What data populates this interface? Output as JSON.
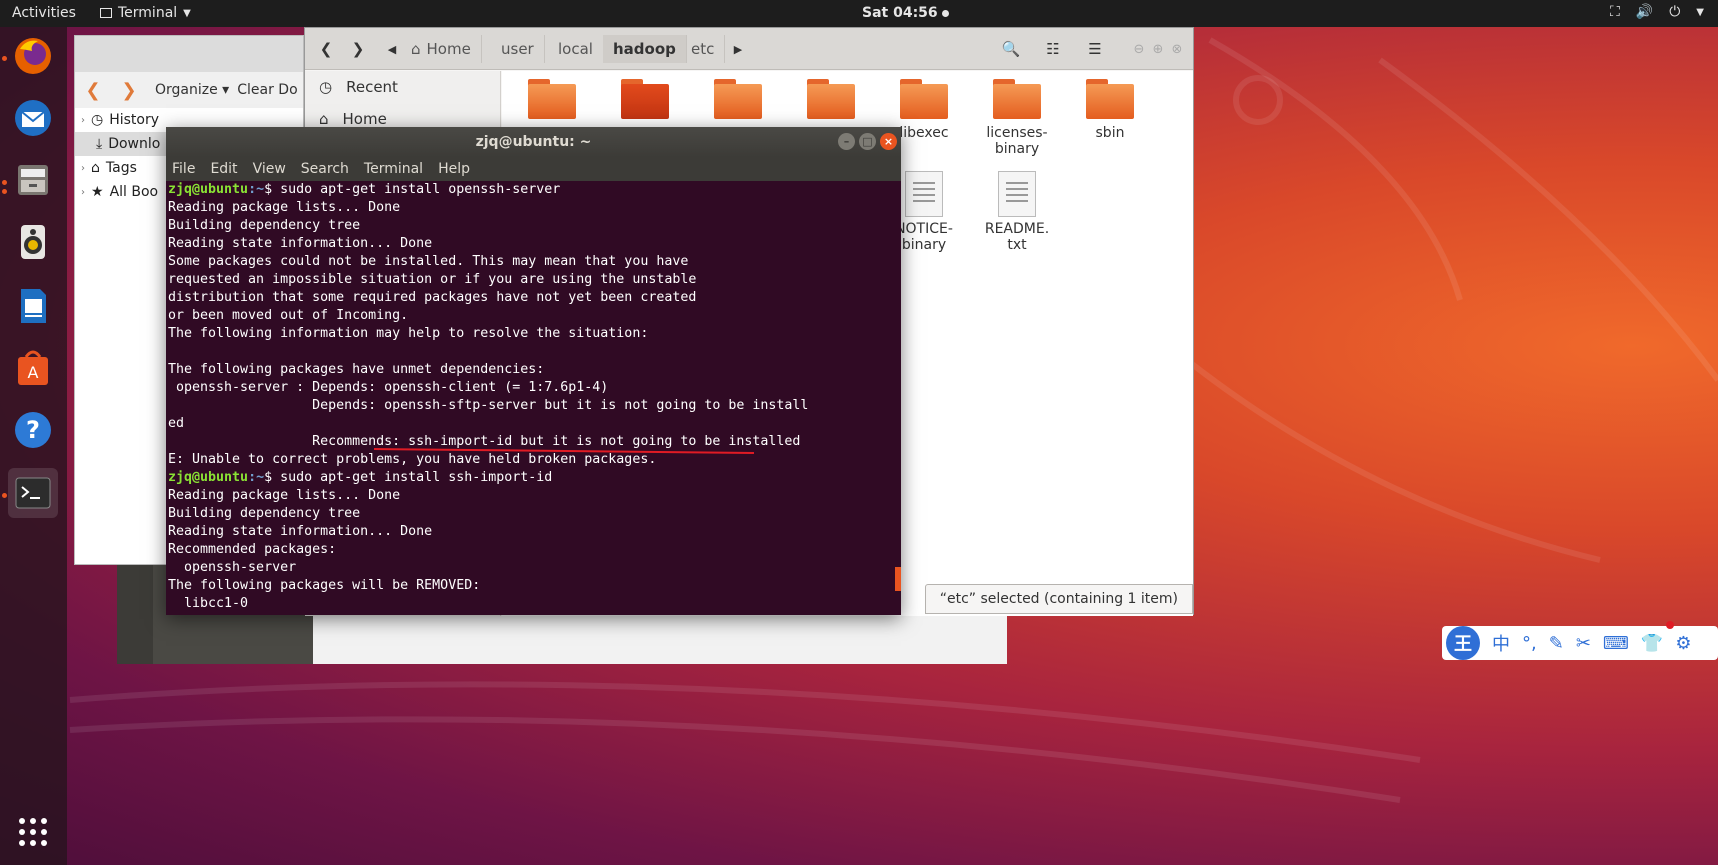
{
  "topbar": {
    "activities": "Activities",
    "app_name": "Terminal",
    "clock": "Sat 04:56"
  },
  "dock": {
    "items": [
      "firefox-icon",
      "thunderbird-icon",
      "files-icon",
      "rhythmbox-icon",
      "writer-icon",
      "software-icon",
      "help-icon",
      "terminal-icon"
    ]
  },
  "library_window": {
    "organize": "Organize",
    "clear": "Clear Do",
    "tree": [
      "History",
      "Downlo",
      "Tags",
      "All Boo"
    ]
  },
  "files_window": {
    "breadcrumbs": [
      "Home",
      "user",
      "local",
      "hadoop",
      "etc"
    ],
    "sidebar": [
      "Recent",
      "Home"
    ],
    "items": [
      {
        "label": "",
        "kind": "folder"
      },
      {
        "label": "",
        "kind": "folder-dark"
      },
      {
        "label": "",
        "kind": "folder"
      },
      {
        "label": "",
        "kind": "folder"
      },
      {
        "label": "libexec",
        "kind": "folder"
      },
      {
        "label": "licenses-\nbinary",
        "kind": "folder"
      },
      {
        "label": "sbin",
        "kind": "folder"
      },
      {
        "label": "NOTICE-\nbinary",
        "kind": "doc"
      },
      {
        "label": "README.\ntxt",
        "kind": "doc"
      }
    ],
    "status": "“etc” selected  (containing 1 item)"
  },
  "terminal": {
    "title": "zjq@ubuntu: ~",
    "menu": [
      "File",
      "Edit",
      "View",
      "Search",
      "Terminal",
      "Help"
    ],
    "prompt_user": "zjq@ubuntu",
    "prompt_path": ":~",
    "lines": [
      {
        "prompt": true,
        "text": "$ sudo apt-get install openssh-server"
      },
      {
        "prompt": false,
        "text": "Reading package lists... Done"
      },
      {
        "prompt": false,
        "text": "Building dependency tree"
      },
      {
        "prompt": false,
        "text": "Reading state information... Done"
      },
      {
        "prompt": false,
        "text": "Some packages could not be installed. This may mean that you have"
      },
      {
        "prompt": false,
        "text": "requested an impossible situation or if you are using the unstable"
      },
      {
        "prompt": false,
        "text": "distribution that some required packages have not yet been created"
      },
      {
        "prompt": false,
        "text": "or been moved out of Incoming."
      },
      {
        "prompt": false,
        "text": "The following information may help to resolve the situation:"
      },
      {
        "prompt": false,
        "text": ""
      },
      {
        "prompt": false,
        "text": "The following packages have unmet dependencies:"
      },
      {
        "prompt": false,
        "text": " openssh-server : Depends: openssh-client (= 1:7.6p1-4)"
      },
      {
        "prompt": false,
        "text": "                  Depends: openssh-sftp-server but it is not going to be install"
      },
      {
        "prompt": false,
        "text": "ed"
      },
      {
        "prompt": false,
        "text": "                  Recommends: ssh-import-id but it is not going to be installed"
      },
      {
        "prompt": false,
        "text": "E: Unable to correct problems, you have held broken packages."
      },
      {
        "prompt": true,
        "text": "$ sudo apt-get install ssh-import-id"
      },
      {
        "prompt": false,
        "text": "Reading package lists... Done"
      },
      {
        "prompt": false,
        "text": "Building dependency tree"
      },
      {
        "prompt": false,
        "text": "Reading state information... Done"
      },
      {
        "prompt": false,
        "text": "Recommended packages:"
      },
      {
        "prompt": false,
        "text": "  openssh-server"
      },
      {
        "prompt": false,
        "text": "The following packages will be REMOVED:"
      },
      {
        "prompt": false,
        "text": "  libcc1-0"
      }
    ]
  },
  "ime": {
    "logo": "王",
    "lang": "中"
  }
}
